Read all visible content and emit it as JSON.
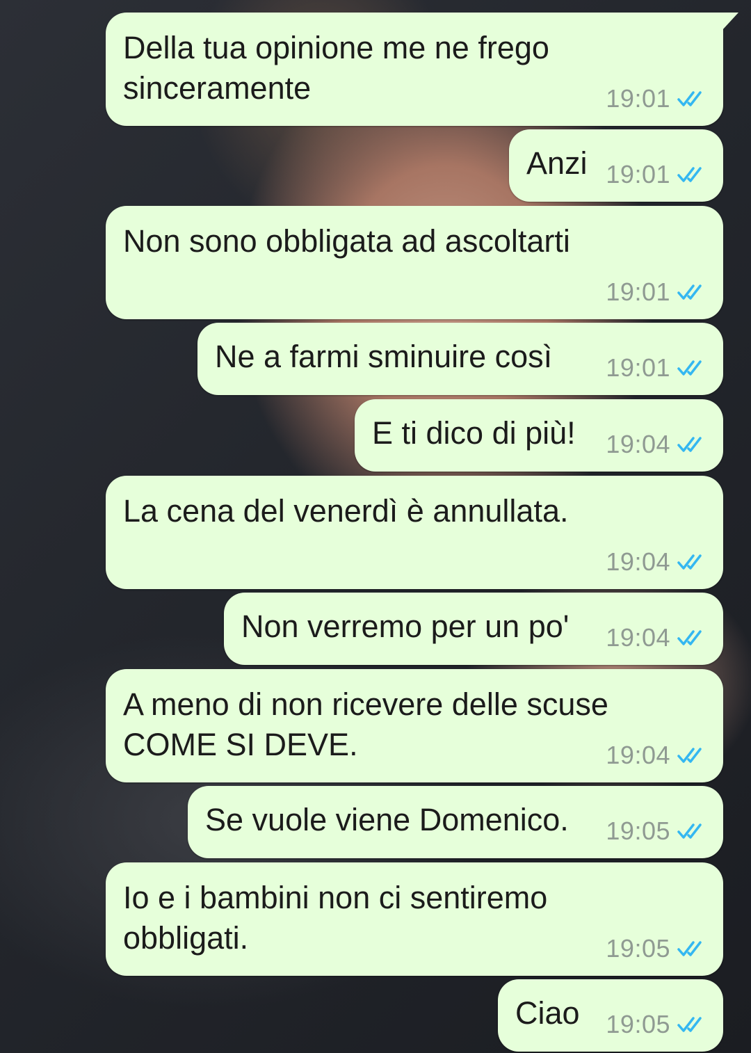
{
  "colors": {
    "bubble_bg": "#e6ffda",
    "text": "#1b1b1b",
    "time": "#8f9a92",
    "read_ticks": "#34b7f1"
  },
  "status_icon": "double-check-read-icon",
  "messages": [
    {
      "text": "Della tua opinione me ne frego\nsinceramente",
      "time": "19:01"
    },
    {
      "text": "Anzi",
      "time": "19:01"
    },
    {
      "text": "Non sono obbligata ad ascoltarti",
      "time": "19:01"
    },
    {
      "text": "Ne a farmi sminuire così",
      "time": "19:01"
    },
    {
      "text": "E ti dico di più!",
      "time": "19:04"
    },
    {
      "text": "La cena del venerdì è annullata.",
      "time": "19:04"
    },
    {
      "text": "Non verremo per un po'",
      "time": "19:04"
    },
    {
      "text": "A meno di non ricevere delle scuse\nCOME SI DEVE.",
      "time": "19:04"
    },
    {
      "text": "Se vuole viene Domenico.",
      "time": "19:05"
    },
    {
      "text": "Io e i bambini non ci sentiremo\nobbligati.",
      "time": "19:05"
    },
    {
      "text": "Ciao",
      "time": "19:05"
    }
  ]
}
